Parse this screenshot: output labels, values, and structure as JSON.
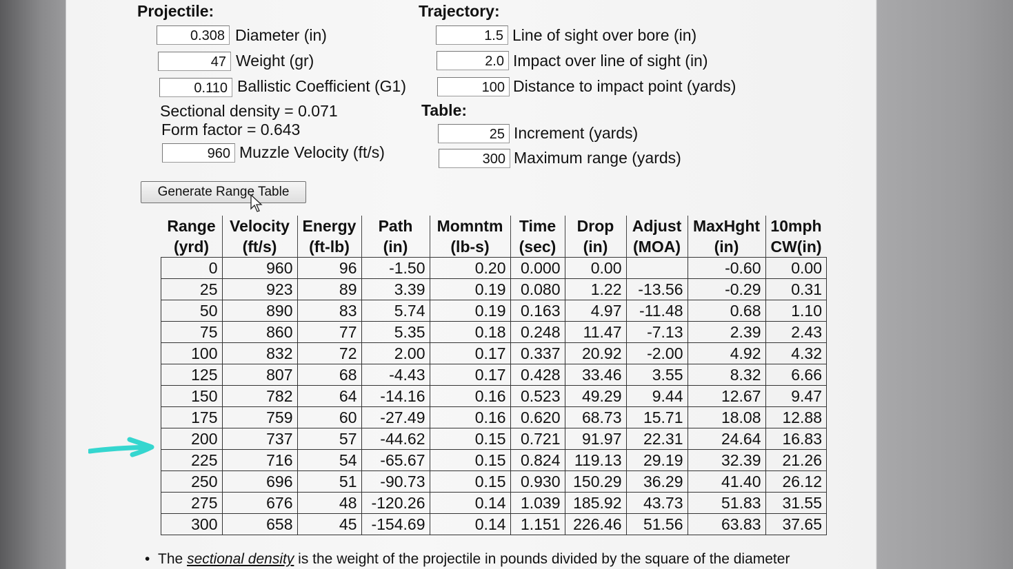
{
  "projectile": {
    "title": "Projectile:",
    "diameter": {
      "value": "0.308",
      "label": "Diameter (in)"
    },
    "weight": {
      "value": "47",
      "label": "Weight (gr)"
    },
    "bc": {
      "value": "0.110",
      "label": "Ballistic Coefficient (G1)"
    },
    "sectional_density": "Sectional density = 0.071",
    "form_factor": "Form factor = 0.643",
    "muzzle_velocity": {
      "value": "960",
      "label": "Muzzle Velocity (ft/s)"
    }
  },
  "trajectory": {
    "title": "Trajectory:",
    "los_over_bore": {
      "value": "1.5",
      "label": "Line of sight over bore (in)"
    },
    "impact_over_los": {
      "value": "2.0",
      "label": "Impact over line of sight (in)"
    },
    "distance_to_impact": {
      "value": "100",
      "label": "Distance to impact point (yards)"
    }
  },
  "table_settings": {
    "title": "Table:",
    "increment": {
      "value": "25",
      "label": "Increment (yards)"
    },
    "max_range": {
      "value": "300",
      "label": "Maximum range (yards)"
    }
  },
  "generate_button": "Generate Range Table",
  "range_table": {
    "headers": [
      [
        "Range",
        "(yrd)"
      ],
      [
        "Velocity",
        "(ft/s)"
      ],
      [
        "Energy",
        "(ft-lb)"
      ],
      [
        "Path",
        "(in)"
      ],
      [
        "Momntm",
        "(lb-s)"
      ],
      [
        "Time",
        "(sec)"
      ],
      [
        "Drop",
        "(in)"
      ],
      [
        "Adjust",
        "(MOA)"
      ],
      [
        "MaxHght",
        "(in)"
      ],
      [
        "10mph",
        "CW(in)"
      ]
    ],
    "rows": [
      [
        "0",
        "960",
        "96",
        "-1.50",
        "0.20",
        "0.000",
        "0.00",
        "",
        "-0.60",
        "0.00"
      ],
      [
        "25",
        "923",
        "89",
        "3.39",
        "0.19",
        "0.080",
        "1.22",
        "-13.56",
        "-0.29",
        "0.31"
      ],
      [
        "50",
        "890",
        "83",
        "5.74",
        "0.19",
        "0.163",
        "4.97",
        "-11.48",
        "0.68",
        "1.10"
      ],
      [
        "75",
        "860",
        "77",
        "5.35",
        "0.18",
        "0.248",
        "11.47",
        "-7.13",
        "2.39",
        "2.43"
      ],
      [
        "100",
        "832",
        "72",
        "2.00",
        "0.17",
        "0.337",
        "20.92",
        "-2.00",
        "4.92",
        "4.32"
      ],
      [
        "125",
        "807",
        "68",
        "-4.43",
        "0.17",
        "0.428",
        "33.46",
        "3.55",
        "8.32",
        "6.66"
      ],
      [
        "150",
        "782",
        "64",
        "-14.16",
        "0.16",
        "0.523",
        "49.29",
        "9.44",
        "12.67",
        "9.47"
      ],
      [
        "175",
        "759",
        "60",
        "-27.49",
        "0.16",
        "0.620",
        "68.73",
        "15.71",
        "18.08",
        "12.88"
      ],
      [
        "200",
        "737",
        "57",
        "-44.62",
        "0.15",
        "0.721",
        "91.97",
        "22.31",
        "24.64",
        "16.83"
      ],
      [
        "225",
        "716",
        "54",
        "-65.67",
        "0.15",
        "0.824",
        "119.13",
        "29.19",
        "32.39",
        "21.26"
      ],
      [
        "250",
        "696",
        "51",
        "-90.73",
        "0.15",
        "0.930",
        "150.29",
        "36.29",
        "41.40",
        "26.12"
      ],
      [
        "275",
        "676",
        "48",
        "-120.26",
        "0.14",
        "1.039",
        "185.92",
        "43.73",
        "51.83",
        "31.55"
      ],
      [
        "300",
        "658",
        "45",
        "-154.69",
        "0.14",
        "1.151",
        "226.46",
        "51.56",
        "63.83",
        "37.65"
      ]
    ]
  },
  "footnote": {
    "pre": "The ",
    "term": "sectional density",
    "post": " is the weight of the projectile in pounds divided by the square of the diameter"
  },
  "colors": {
    "annotation_arrow": "#35d6cf"
  }
}
